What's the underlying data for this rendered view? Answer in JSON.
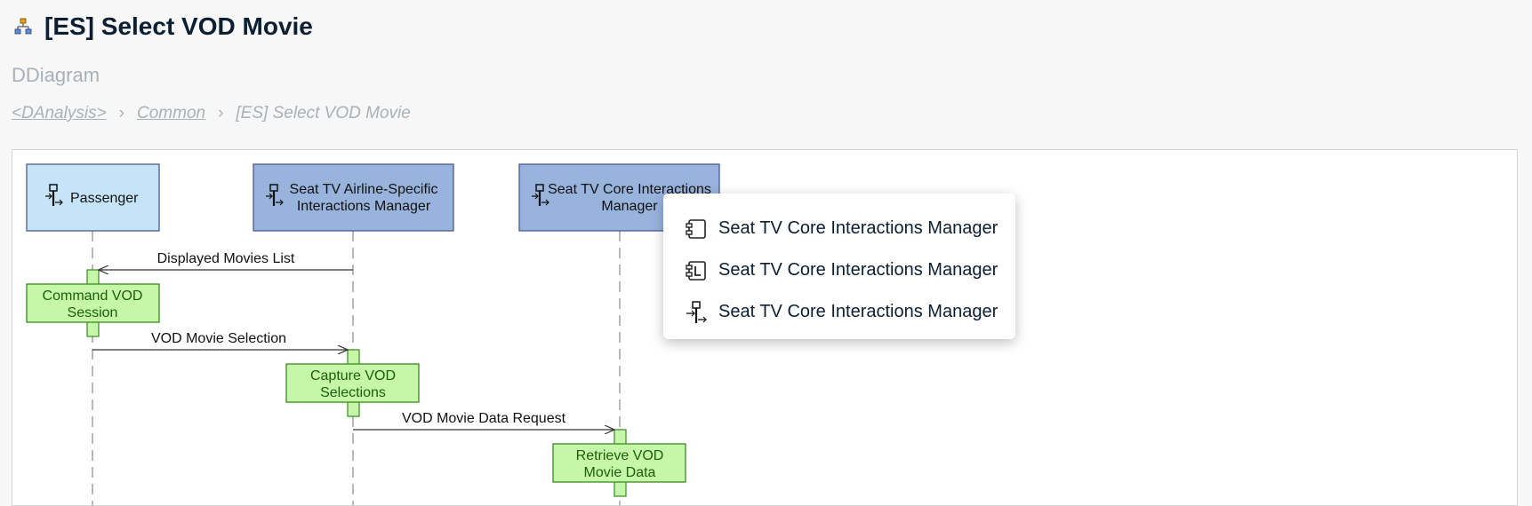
{
  "header": {
    "title": "[ES] Select VOD Movie",
    "subtitle": "DDiagram"
  },
  "breadcrumb": {
    "items": [
      "<DAnalysis>",
      "Common",
      "[ES] Select VOD Movie"
    ],
    "separator": "›"
  },
  "diagram": {
    "lifelines": [
      {
        "label_lines": [
          "Passenger"
        ]
      },
      {
        "label_lines": [
          "Seat TV Airline-Specific",
          "Interactions Manager"
        ]
      },
      {
        "label_lines": [
          "Seat TV Core Interactions",
          "Manager"
        ]
      }
    ],
    "messages": [
      {
        "label": "Displayed Movies List"
      },
      {
        "label": "VOD Movie Selection"
      },
      {
        "label": "VOD Movie Data Request"
      }
    ],
    "functions": [
      {
        "label_lines": [
          "Command VOD",
          "Session"
        ]
      },
      {
        "label_lines": [
          "Capture VOD",
          "Selections"
        ]
      },
      {
        "label_lines": [
          "Retrieve VOD",
          "Movie Data"
        ]
      }
    ],
    "colors": {
      "actor_fill": "#c6e4f8",
      "component_fill": "#98b3dc",
      "box_border": "#4a5b8c",
      "function_fill": "#c6f7a8",
      "function_border": "#3a8a1f"
    }
  },
  "popup": {
    "items": [
      {
        "label": "Seat TV Core Interactions Manager",
        "icon": "component-icon"
      },
      {
        "label": "Seat TV Core Interactions Manager",
        "icon": "logical-component-icon"
      },
      {
        "label": "Seat TV Core Interactions Manager",
        "icon": "actor-lifeline-icon"
      }
    ]
  }
}
